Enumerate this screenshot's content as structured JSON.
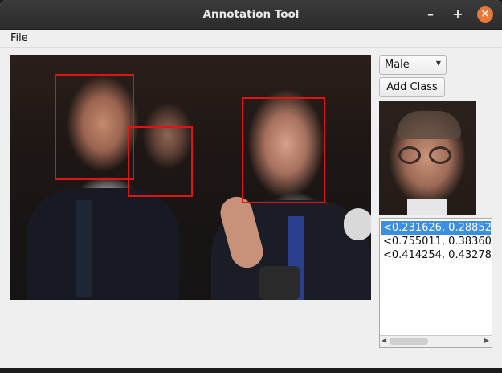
{
  "window": {
    "title": "Annotation Tool",
    "controls": {
      "minimize": "–",
      "maximize": "+",
      "close": "×"
    },
    "accent_color": "#e9783b"
  },
  "menubar": {
    "file_label": "File"
  },
  "image_view": {
    "box_color": "#e11414",
    "box_count": 3
  },
  "controls": {
    "class_select_value": "Male",
    "add_class_label": "Add Class"
  },
  "annotations_list": {
    "items": [
      {
        "text": "<0.231626, 0.28852",
        "selected": true
      },
      {
        "text": "<0.755011, 0.38360",
        "selected": false
      },
      {
        "text": "<0.414254, 0.43278",
        "selected": false
      }
    ],
    "selection_color": "#3d8ee0"
  }
}
